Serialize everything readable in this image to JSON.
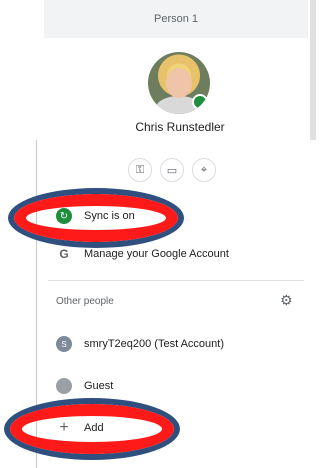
{
  "header": {
    "person_label": "Person 1"
  },
  "profile": {
    "name": "Chris Runstedler"
  },
  "quick_actions": [
    {
      "icon": "key-icon",
      "glyph": "⚿"
    },
    {
      "icon": "card-icon",
      "glyph": "▭"
    },
    {
      "icon": "location-pin-icon",
      "glyph": "⌖"
    }
  ],
  "menu": {
    "sync_label": "Sync is on",
    "manage_label": "Manage your Google Account"
  },
  "other_people": {
    "section_label": "Other people",
    "accounts": [
      {
        "initial": "S",
        "label": "smryT2eq200 (Test Account)"
      },
      {
        "initial": "",
        "label": "Guest"
      }
    ],
    "add_label": "Add"
  },
  "colors": {
    "highlight": "#ff1a1a",
    "highlight_outline": "#2f4f7f",
    "sync_green": "#1e8e3e"
  }
}
